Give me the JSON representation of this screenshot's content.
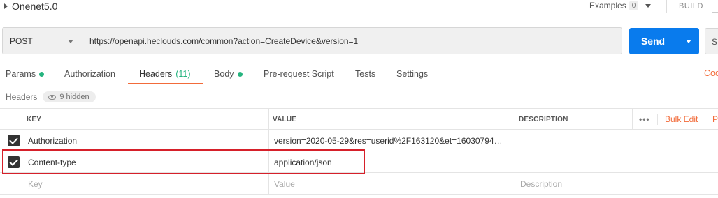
{
  "topbar": {
    "collection_title": "Onenet5.0",
    "examples_label": "Examples",
    "examples_count": "0",
    "build_label": "BUILD"
  },
  "request": {
    "method": "POST",
    "url": "https://openapi.heclouds.com/common?action=CreateDevice&version=1",
    "send_label": "Send",
    "save_label": "S"
  },
  "tabs": [
    {
      "label": "Params",
      "dot": true
    },
    {
      "label": "Authorization"
    },
    {
      "label": "Headers",
      "count": "(11)",
      "active": true
    },
    {
      "label": "Body",
      "dot": true
    },
    {
      "label": "Pre-request Script"
    },
    {
      "label": "Tests"
    },
    {
      "label": "Settings"
    }
  ],
  "cookies_label": "Coo",
  "headers_section": {
    "title": "Headers",
    "hidden_label": "9 hidden"
  },
  "table": {
    "columns": [
      "KEY",
      "VALUE",
      "DESCRIPTION"
    ],
    "more_label": "•••",
    "bulk_edit_label": "Bulk Edit",
    "presets_label": "P",
    "rows": [
      {
        "checked": true,
        "key": "Authorization",
        "value": "version=2020-05-29&res=userid%2F163120&et=16030794…",
        "description": ""
      },
      {
        "checked": true,
        "key": "Content-type",
        "value": "application/json",
        "description": ""
      }
    ],
    "placeholder": {
      "key": "Key",
      "value": "Value",
      "description": "Description"
    }
  },
  "colors": {
    "accent": "#f26b3a",
    "send": "#097bed",
    "dot": "#26b47f",
    "highlight": "#d6202a"
  }
}
